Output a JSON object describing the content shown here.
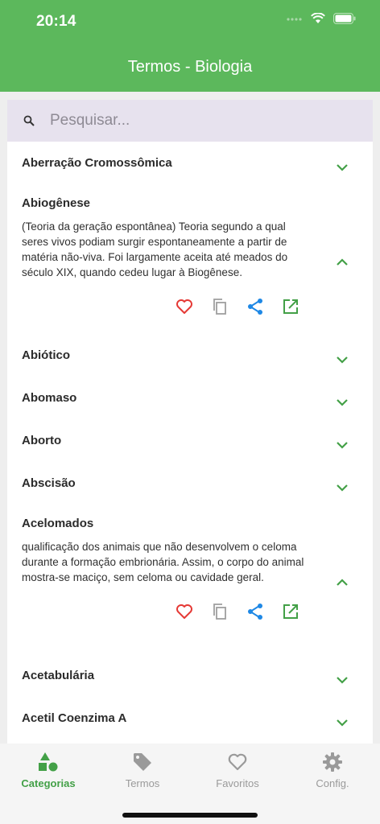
{
  "status": {
    "time": "20:14"
  },
  "header": {
    "title": "Termos - Biologia"
  },
  "search": {
    "placeholder": "Pesquisar..."
  },
  "terms": [
    {
      "title": "Aberração Cromossômica",
      "expanded": false
    },
    {
      "title": "Abiogênese",
      "expanded": true,
      "description": "(Teoria da geração espontânea) Teoria segundo a qual seres vivos podiam surgir espontaneamente a partir de matéria não-viva. Foi largamente aceita até meados do século XIX, quando cedeu lugar à Biogênese."
    },
    {
      "title": "Abiótico",
      "expanded": false
    },
    {
      "title": "Abomaso",
      "expanded": false
    },
    {
      "title": "Aborto",
      "expanded": false
    },
    {
      "title": "Abscisão",
      "expanded": false
    },
    {
      "title": "Acelomados",
      "expanded": true,
      "description": "qualificação dos animais que não desenvolvem o celoma durante a formação embrionária. Assim, o corpo do animal mostra-se maciço, sem celoma ou cavidade geral."
    },
    {
      "title": "Acetabulária",
      "expanded": false
    },
    {
      "title": "Acetil Coenzima A",
      "expanded": false
    }
  ],
  "actions": {
    "icons": [
      "heart-icon",
      "copy-icon",
      "share-icon",
      "open-external-icon"
    ]
  },
  "nav": [
    {
      "label": "Categorias",
      "icon": "categories-icon",
      "active": true
    },
    {
      "label": "Termos",
      "icon": "tag-icon",
      "active": false
    },
    {
      "label": "Favoritos",
      "icon": "heart-outline-icon",
      "active": false
    },
    {
      "label": "Config.",
      "icon": "gear-icon",
      "active": false
    }
  ],
  "colors": {
    "primary": "#5cb85c",
    "accent": "#43a047",
    "heart": "#e53935",
    "share": "#1e88e5",
    "searchBg": "#e7e2ee"
  }
}
